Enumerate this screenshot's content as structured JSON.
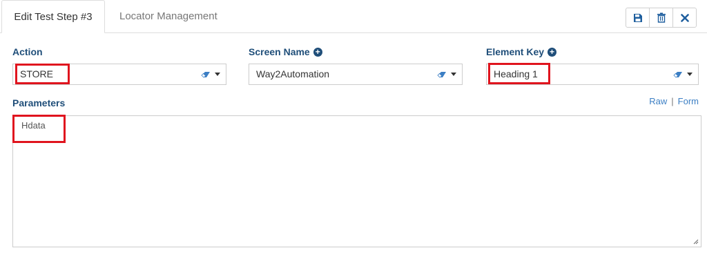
{
  "tabs": [
    {
      "label": "Edit Test Step #3",
      "active": true
    },
    {
      "label": "Locator Management",
      "active": false
    }
  ],
  "toolbar": {
    "icons": [
      "save-icon",
      "trash-icon",
      "close-icon"
    ],
    "accent_color": "#1f5f9e"
  },
  "fields": {
    "action": {
      "label": "Action",
      "value": "STORE"
    },
    "screen_name": {
      "label": "Screen Name",
      "value": "Way2Automation"
    },
    "element_key": {
      "label": "Element Key",
      "value": "Heading 1"
    }
  },
  "parameters": {
    "label": "Parameters",
    "value": "Hdata",
    "modes": {
      "raw": "Raw",
      "separator": "|",
      "form": "Form"
    }
  },
  "colors": {
    "label": "#1f4e79",
    "link": "#3c7fc4",
    "highlight": "#e0141e"
  }
}
